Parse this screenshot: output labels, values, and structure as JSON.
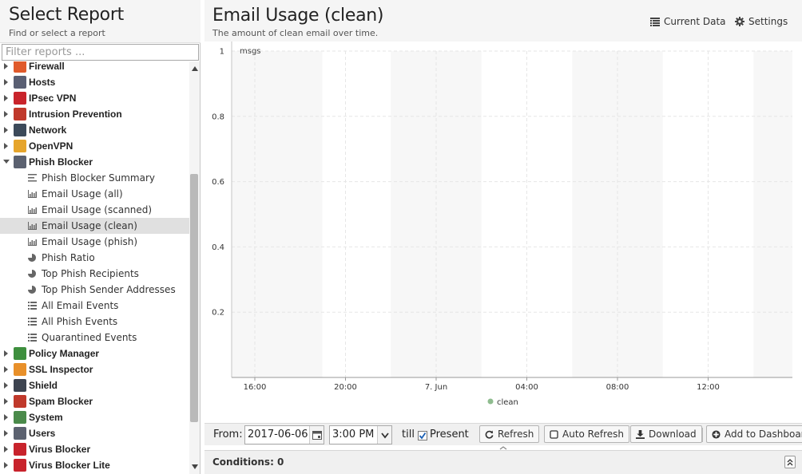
{
  "left_panel": {
    "title": "Select Report",
    "subtitle": "Find or select a report",
    "filter_placeholder": "Filter reports ..."
  },
  "tree": [
    {
      "type": "app",
      "label": "Firewall",
      "icon": "firewall-icon",
      "color": "#e05a2b",
      "open": false
    },
    {
      "type": "app",
      "label": "Hosts",
      "icon": "hosts-icon",
      "color": "#5a5f73",
      "open": false
    },
    {
      "type": "app",
      "label": "IPsec VPN",
      "icon": "lock-icon",
      "color": "#c9242b",
      "open": false
    },
    {
      "type": "app",
      "label": "Intrusion Prevention",
      "icon": "intrusion-prevention-icon",
      "color": "#c0392b",
      "open": false
    },
    {
      "type": "app",
      "label": "Network",
      "icon": "network-icon",
      "color": "#3c4a5a",
      "open": false
    },
    {
      "type": "app",
      "label": "OpenVPN",
      "icon": "globe-icon",
      "color": "#e6a52c",
      "open": false
    },
    {
      "type": "app",
      "label": "Phish Blocker",
      "icon": "phish-blocker-icon",
      "color": "#5b6170",
      "open": true
    },
    {
      "type": "leaf",
      "label": "Phish Blocker Summary",
      "icon": "text-icon"
    },
    {
      "type": "leaf",
      "label": "Email Usage (all)",
      "icon": "bar-chart-icon"
    },
    {
      "type": "leaf",
      "label": "Email Usage (scanned)",
      "icon": "bar-chart-icon"
    },
    {
      "type": "leaf",
      "label": "Email Usage (clean)",
      "icon": "bar-chart-icon",
      "selected": true
    },
    {
      "type": "leaf",
      "label": "Email Usage (phish)",
      "icon": "bar-chart-icon"
    },
    {
      "type": "leaf",
      "label": "Phish Ratio",
      "icon": "pie-chart-icon"
    },
    {
      "type": "leaf",
      "label": "Top Phish Recipients",
      "icon": "pie-chart-icon"
    },
    {
      "type": "leaf",
      "label": "Top Phish Sender Addresses",
      "icon": "pie-chart-icon"
    },
    {
      "type": "leaf",
      "label": "All Email Events",
      "icon": "list-icon"
    },
    {
      "type": "leaf",
      "label": "All Phish Events",
      "icon": "list-icon"
    },
    {
      "type": "leaf",
      "label": "Quarantined Events",
      "icon": "list-icon"
    },
    {
      "type": "app",
      "label": "Policy Manager",
      "icon": "policy-manager-icon",
      "color": "#3e8f3e",
      "open": false
    },
    {
      "type": "app",
      "label": "SSL Inspector",
      "icon": "ssl-inspector-icon",
      "color": "#e8902a",
      "open": false
    },
    {
      "type": "app",
      "label": "Shield",
      "icon": "shield-icon",
      "color": "#3d4450",
      "open": false
    },
    {
      "type": "app",
      "label": "Spam Blocker",
      "icon": "spam-blocker-icon",
      "color": "#c0392b",
      "open": false
    },
    {
      "type": "app",
      "label": "System",
      "icon": "system-icon",
      "color": "#4a8a4a",
      "open": false
    },
    {
      "type": "app",
      "label": "Users",
      "icon": "users-icon",
      "color": "#5c6270",
      "open": false
    },
    {
      "type": "app",
      "label": "Virus Blocker",
      "icon": "virus-blocker-icon",
      "color": "#c8232c",
      "open": false
    },
    {
      "type": "app",
      "label": "Virus Blocker Lite",
      "icon": "virus-blocker-lite-icon",
      "color": "#c8232c",
      "open": false
    }
  ],
  "report": {
    "title": "Email Usage (clean)",
    "description": "The amount of clean email over time.",
    "current_data_label": "Current Data",
    "settings_label": "Settings"
  },
  "chart_data": {
    "type": "line",
    "ylabel": "msgs",
    "ylim": [
      0,
      1
    ],
    "yticks": [
      "0.2",
      "0.4",
      "0.6",
      "0.8",
      "1"
    ],
    "xticks": [
      "16:00",
      "20:00",
      "7. Jun",
      "04:00",
      "08:00",
      "12:00"
    ],
    "series": [
      {
        "name": "clean",
        "color": "#8fbc8f",
        "values": []
      }
    ],
    "grid": true,
    "legend": "bottom"
  },
  "toolbar": {
    "from_label": "From:",
    "from_date": "2017-06-06",
    "from_time": "3:00 PM",
    "till_label": "till",
    "present_label": "Present",
    "present_checked": true,
    "refresh_label": "Refresh",
    "auto_refresh_label": "Auto Refresh",
    "download_label": "Download",
    "add_dashboard_label": "Add to Dashboard"
  },
  "conditions": {
    "title": "Conditions: 0"
  }
}
